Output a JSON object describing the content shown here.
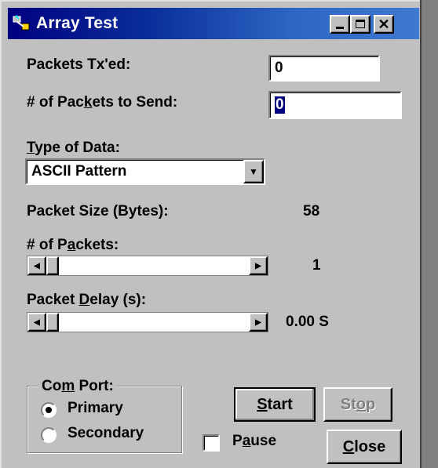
{
  "window": {
    "title": "Array Test",
    "icon": "app-cable-icon"
  },
  "titlebar_buttons": {
    "minimize": "_",
    "maximize": "□",
    "close": "✕"
  },
  "packets_txed": {
    "label_pre": "Packets Tx'ed:",
    "value": "0"
  },
  "packets_to_send": {
    "label_a": "# of Pac",
    "label_u": "k",
    "label_b": "ets to Send:",
    "value": "0"
  },
  "type_of_data": {
    "label_u": "T",
    "label_rest": "ype of Data:",
    "selected": "ASCII Pattern",
    "arrow": "▼"
  },
  "packet_size": {
    "label": "Packet Size (Bytes):",
    "value": "58"
  },
  "num_packets": {
    "label_a": "# of P",
    "label_u": "a",
    "label_b": "ckets:",
    "value": "1",
    "fill": 0.0
  },
  "packet_delay": {
    "label_a": "Packet ",
    "label_u": "D",
    "label_b": "elay (s):",
    "value": "0.00 S",
    "fill": 0.0
  },
  "com_port": {
    "label_a": "Co",
    "label_u": "m",
    "label_b": " Port:",
    "options": [
      "Primary",
      "Secondary"
    ],
    "selected": "Primary"
  },
  "buttons": {
    "start_u": "S",
    "start_rest": "tart",
    "stop_a": "St",
    "stop_u": "o",
    "stop_b": "p",
    "close_u": "C",
    "close_rest": "lose"
  },
  "pause": {
    "label_a": "P",
    "label_u": "a",
    "label_b": "use",
    "checked": false
  },
  "scroll_arrows": {
    "left": "◀",
    "right": "▶"
  }
}
